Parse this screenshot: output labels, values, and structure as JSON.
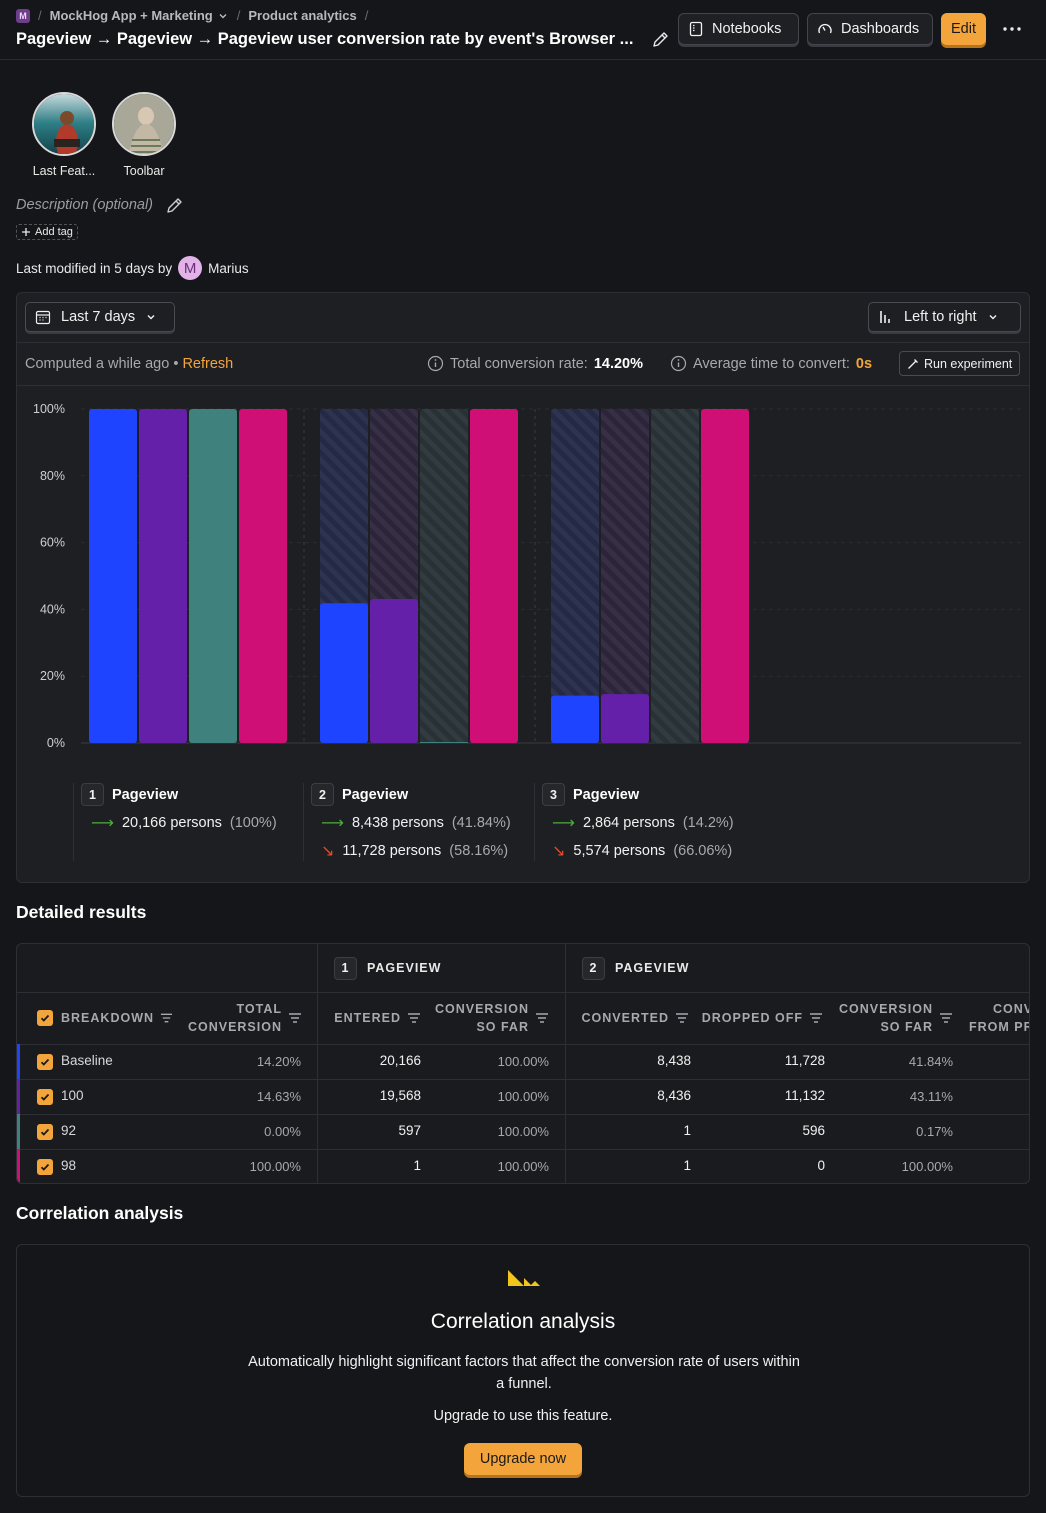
{
  "breadcrumbs": {
    "project_badge": "M",
    "project": "MockHog App + Marketing",
    "section": "Product analytics"
  },
  "title": "Pageview → Pageview → Pageview user conversion rate by event's Browser ...",
  "header_buttons": {
    "notebooks": "Notebooks",
    "dashboards": "Dashboards",
    "edit": "Edit"
  },
  "avatars": [
    {
      "label": "Last Feat..."
    },
    {
      "label": "Toolbar"
    }
  ],
  "description_placeholder": "Description (optional)",
  "add_tag": "Add tag",
  "last_modified": {
    "prefix": "Last modified in 5 days by",
    "user_initial": "M",
    "user": "Marius"
  },
  "controls": {
    "date_range": "Last 7 days",
    "layout": "Left to right"
  },
  "status": {
    "computed": "Computed a while ago",
    "bullet": "•",
    "refresh": "Refresh",
    "total_conversion_label": "Total conversion rate:",
    "total_conversion_value": "14.20%",
    "avg_time_label": "Average time to convert:",
    "avg_time_value": "0s",
    "run_experiment": "Run experiment"
  },
  "chart_data": {
    "type": "bar",
    "y_ticks": [
      "100%",
      "80%",
      "60%",
      "40%",
      "20%",
      "0%"
    ],
    "ylim": [
      0,
      100
    ],
    "categories": [
      "Pageview",
      "Pageview",
      "Pageview"
    ],
    "series": [
      {
        "name": "Baseline",
        "color": "#1f44ff",
        "values": [
          100,
          41.84,
          14.2
        ]
      },
      {
        "name": "100",
        "color": "#6420a8",
        "values": [
          100,
          43.11,
          14.63
        ]
      },
      {
        "name": "92",
        "color": "#3e817d",
        "values": [
          100,
          0.17,
          0.0
        ]
      },
      {
        "name": "98",
        "color": "#cf0f75",
        "values": [
          100,
          100,
          100
        ]
      }
    ]
  },
  "steps": [
    {
      "num": "1",
      "name": "Pageview",
      "converted": "20,166 persons",
      "converted_pct": "(100%)",
      "dropped": "",
      "dropped_pct": ""
    },
    {
      "num": "2",
      "name": "Pageview",
      "converted": "8,438 persons",
      "converted_pct": "(41.84%)",
      "dropped": "11,728 persons",
      "dropped_pct": "(58.16%)"
    },
    {
      "num": "3",
      "name": "Pageview",
      "converted": "2,864 persons",
      "converted_pct": "(14.2%)",
      "dropped": "5,574 persons",
      "dropped_pct": "(66.06%)"
    }
  ],
  "detailed_results": {
    "heading": "Detailed results",
    "step_headers": [
      {
        "num": "1",
        "label": "PAGEVIEW"
      },
      {
        "num": "2",
        "label": "PAGEVIEW"
      }
    ],
    "columns": {
      "breakdown": "BREAKDOWN",
      "total_conversion_1": "TOTAL",
      "total_conversion_2": "CONVERSION",
      "entered": "ENTERED",
      "conv_so_far_1": "CONVERSION",
      "conv_so_far_2": "SO FAR",
      "converted": "CONVERTED",
      "dropped_off": "DROPPED OFF",
      "conv_so_far_b1": "CONVERSION",
      "conv_so_far_b2": "SO FAR",
      "conv_from_prev_1": "CONV",
      "conv_from_prev_2": "FROM PR"
    },
    "rows": [
      {
        "breakdown": "Baseline",
        "color": "#1f44ff",
        "total": "14.20%",
        "entered": "20,166",
        "so_far": "100.00%",
        "converted": "8,438",
        "dropped": "11,728",
        "so_far2": "41.84%"
      },
      {
        "breakdown": "100",
        "color": "#6420a8",
        "total": "14.63%",
        "entered": "19,568",
        "so_far": "100.00%",
        "converted": "8,436",
        "dropped": "11,132",
        "so_far2": "43.11%"
      },
      {
        "breakdown": "92",
        "color": "#3e817d",
        "total": "0.00%",
        "entered": "597",
        "so_far": "100.00%",
        "converted": "1",
        "dropped": "596",
        "so_far2": "0.17%"
      },
      {
        "breakdown": "98",
        "color": "#cf0f75",
        "total": "100.00%",
        "entered": "1",
        "so_far": "100.00%",
        "converted": "1",
        "dropped": "0",
        "so_far2": "100.00%"
      }
    ]
  },
  "correlation": {
    "heading": "Correlation analysis",
    "title": "Correlation analysis",
    "text": "Automatically highlight significant factors that affect the conversion rate of users within a funnel.",
    "upgrade_text": "Upgrade to use this feature.",
    "upgrade_button": "Upgrade now"
  },
  "colors": {
    "accent": "#f3a53b",
    "background": "#151619",
    "panel": "#1e1f23"
  }
}
